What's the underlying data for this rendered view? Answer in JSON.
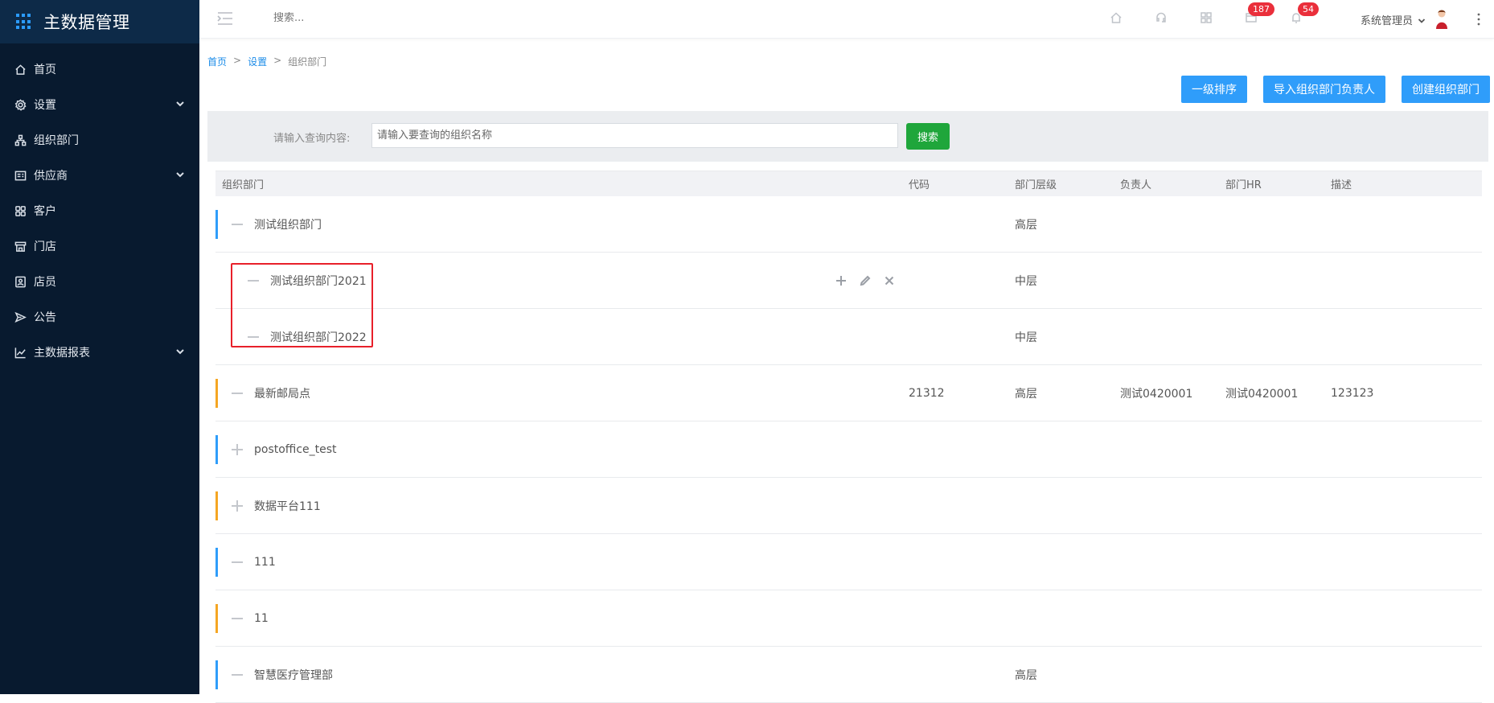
{
  "brand": {
    "title": "主数据管理"
  },
  "sidebar": {
    "items": [
      {
        "label": "首页",
        "icon": "home-icon",
        "expandable": false
      },
      {
        "label": "设置",
        "icon": "gear-icon",
        "expandable": true
      },
      {
        "label": "组织部门",
        "icon": "org-chart-icon",
        "expandable": false
      },
      {
        "label": "供应商",
        "icon": "supplier-icon",
        "expandable": true
      },
      {
        "label": "客户",
        "icon": "customer-icon",
        "expandable": false
      },
      {
        "label": "门店",
        "icon": "store-icon",
        "expandable": false
      },
      {
        "label": "店员",
        "icon": "staff-icon",
        "expandable": false
      },
      {
        "label": "公告",
        "icon": "announcement-icon",
        "expandable": false
      },
      {
        "label": "主数据报表",
        "icon": "chart-icon",
        "expandable": true
      }
    ]
  },
  "header": {
    "search_placeholder": "搜索...",
    "badges": {
      "messages": "187",
      "notifications": "54"
    },
    "user_name": "系统管理员"
  },
  "breadcrumb": {
    "home": "首页",
    "sep": ">",
    "settings": "设置",
    "current": "组织部门"
  },
  "actions": {
    "sort": "一级排序",
    "import": "导入组织部门负责人",
    "create": "创建组织部门"
  },
  "search": {
    "label": "请输入查询内容:",
    "placeholder": "请输入要查询的组织名称",
    "button": "搜索"
  },
  "table": {
    "headers": {
      "name": "组织部门",
      "code": "代码",
      "level": "部门层级",
      "owner": "负责人",
      "hr": "部门HR",
      "desc": "描述"
    },
    "rows": [
      {
        "name": "测试组织部门",
        "code": "",
        "level": "高层",
        "owner": "",
        "hr": "",
        "desc": "",
        "depth": 0,
        "expanded": true,
        "bar_color": "#2f9dfa"
      },
      {
        "name": "测试组织部门2021",
        "code": "",
        "level": "中层",
        "owner": "",
        "hr": "",
        "desc": "",
        "depth": 1,
        "expanded": true,
        "bar_color": ""
      },
      {
        "name": "测试组织部门2022",
        "code": "",
        "level": "中层",
        "owner": "",
        "hr": "",
        "desc": "",
        "depth": 1,
        "expanded": true,
        "bar_color": ""
      },
      {
        "name": "最新邮局点",
        "code": "21312",
        "level": "高层",
        "owner": "测试0420001",
        "hr": "测试0420001",
        "desc": "123123",
        "depth": 0,
        "expanded": true,
        "bar_color": "#f5a623"
      },
      {
        "name": "postoffice_test",
        "code": "",
        "level": "",
        "owner": "",
        "hr": "",
        "desc": "",
        "depth": 0,
        "expanded": false,
        "bar_color": "#2f9dfa"
      },
      {
        "name": "数据平台111",
        "code": "",
        "level": "",
        "owner": "",
        "hr": "",
        "desc": "",
        "depth": 0,
        "expanded": false,
        "bar_color": "#f5a623"
      },
      {
        "name": "111",
        "code": "",
        "level": "",
        "owner": "",
        "hr": "",
        "desc": "",
        "depth": 0,
        "expanded": true,
        "bar_color": "#2f9dfa"
      },
      {
        "name": "11",
        "code": "",
        "level": "",
        "owner": "",
        "hr": "",
        "desc": "",
        "depth": 0,
        "expanded": true,
        "bar_color": "#f5a623"
      },
      {
        "name": "智慧医疗管理部",
        "code": "",
        "level": "高层",
        "owner": "",
        "hr": "",
        "desc": "",
        "depth": 0,
        "expanded": true,
        "bar_color": "#2f9dfa"
      }
    ]
  }
}
